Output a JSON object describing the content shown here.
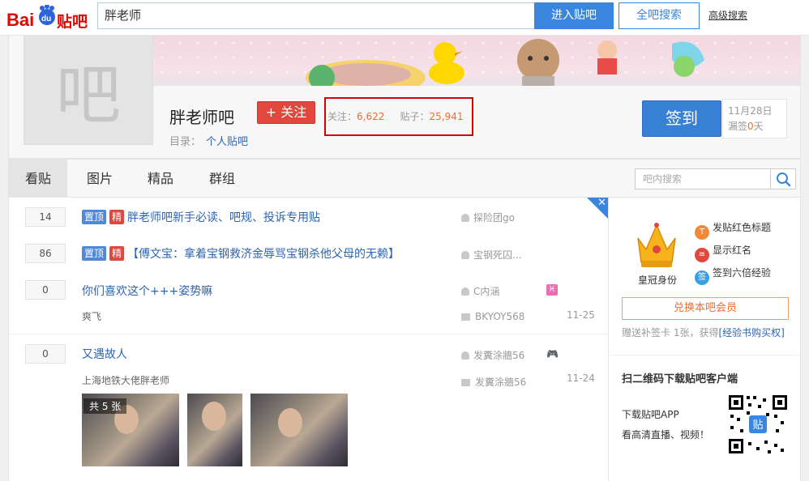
{
  "topbar": {
    "logo_text": "Bai贴吧",
    "search_value": "胖老师",
    "enter_button": "进入贴吧",
    "all_search_button": "全吧搜索",
    "advanced_search": "高级搜索"
  },
  "forum": {
    "avatar_char": "吧",
    "name": "胖老师吧",
    "follow_label": "+ 关注",
    "follow_count_label": "关注：",
    "follow_count": "6,622",
    "post_count_label": "贴子：",
    "post_count": "25,941",
    "catalog_label": "目录：",
    "catalog_value": "个人贴吧",
    "sign_button": "签到",
    "sign_date": "11月28日",
    "missed_prefix": "漏签",
    "missed_days": "0",
    "missed_suffix": "天"
  },
  "nav": {
    "tabs": [
      {
        "label": "看贴"
      },
      {
        "label": "图片"
      },
      {
        "label": "精品"
      },
      {
        "label": "群组"
      }
    ],
    "search_placeholder": "吧内搜索"
  },
  "threads": [
    {
      "replies": "14",
      "badge_top": "置顶",
      "badge_jing": "精",
      "title": "胖老师吧新手必读、吧规、投诉专用贴",
      "author": "探险团go"
    },
    {
      "replies": "86",
      "badge_top": "置顶",
      "badge_jing": "精",
      "title": "【傅文宝：拿着宝钢救济金辱骂宝钢杀他父母的无赖】",
      "author": "宝钢死囚..."
    },
    {
      "replies": "0",
      "title": "你们喜欢这个+++姿势嘛",
      "author": "C内涵",
      "abstract": "爽飞",
      "last_reply": "BKYOY568",
      "date": "11-25"
    },
    {
      "replies": "0",
      "title": "又遇故人",
      "author": "发糞涂牆56",
      "abstract": "上海地铁大佬胖老师",
      "last_reply": "发糞涂牆56",
      "date": "11-24",
      "image_count": "共 5 张"
    }
  ],
  "sidebar": {
    "crown_label": "皇冠身份",
    "perks": [
      "发贴红色标题",
      "显示红名",
      "签到六倍经验"
    ],
    "member_button": "兑换本吧会员",
    "gift_text": "赠送补签卡 1张，获得",
    "gift_link": "[经验书购买权]",
    "app_title": "扫二维码下载贴吧客户端",
    "app_line1": "下载贴吧APP",
    "app_line2": "看高清直播、视频！"
  },
  "colors": {
    "accent_blue": "#3a85de",
    "red": "#e1473d",
    "orange": "#f06c31",
    "link": "#2d64b3"
  }
}
